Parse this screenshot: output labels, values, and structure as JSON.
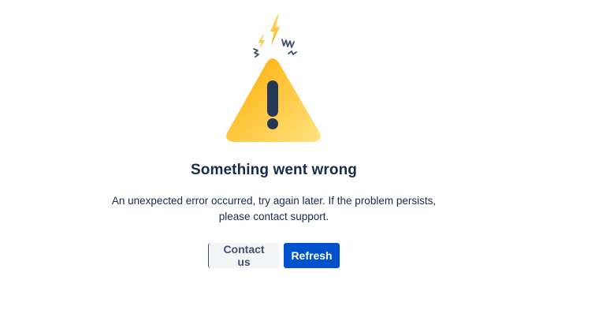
{
  "error": {
    "title": "Something went wrong",
    "message_line1": "An unexpected error occurred, try again later. If the problem persists,",
    "message_line2": "please contact support.",
    "illustration_icon": "warning-triangle-icon"
  },
  "actions": {
    "contact_label": "Contact us",
    "refresh_label": "Refresh"
  },
  "colors": {
    "primary": "#0052CC",
    "text": "#172B4D",
    "warning": "#FFC400"
  }
}
